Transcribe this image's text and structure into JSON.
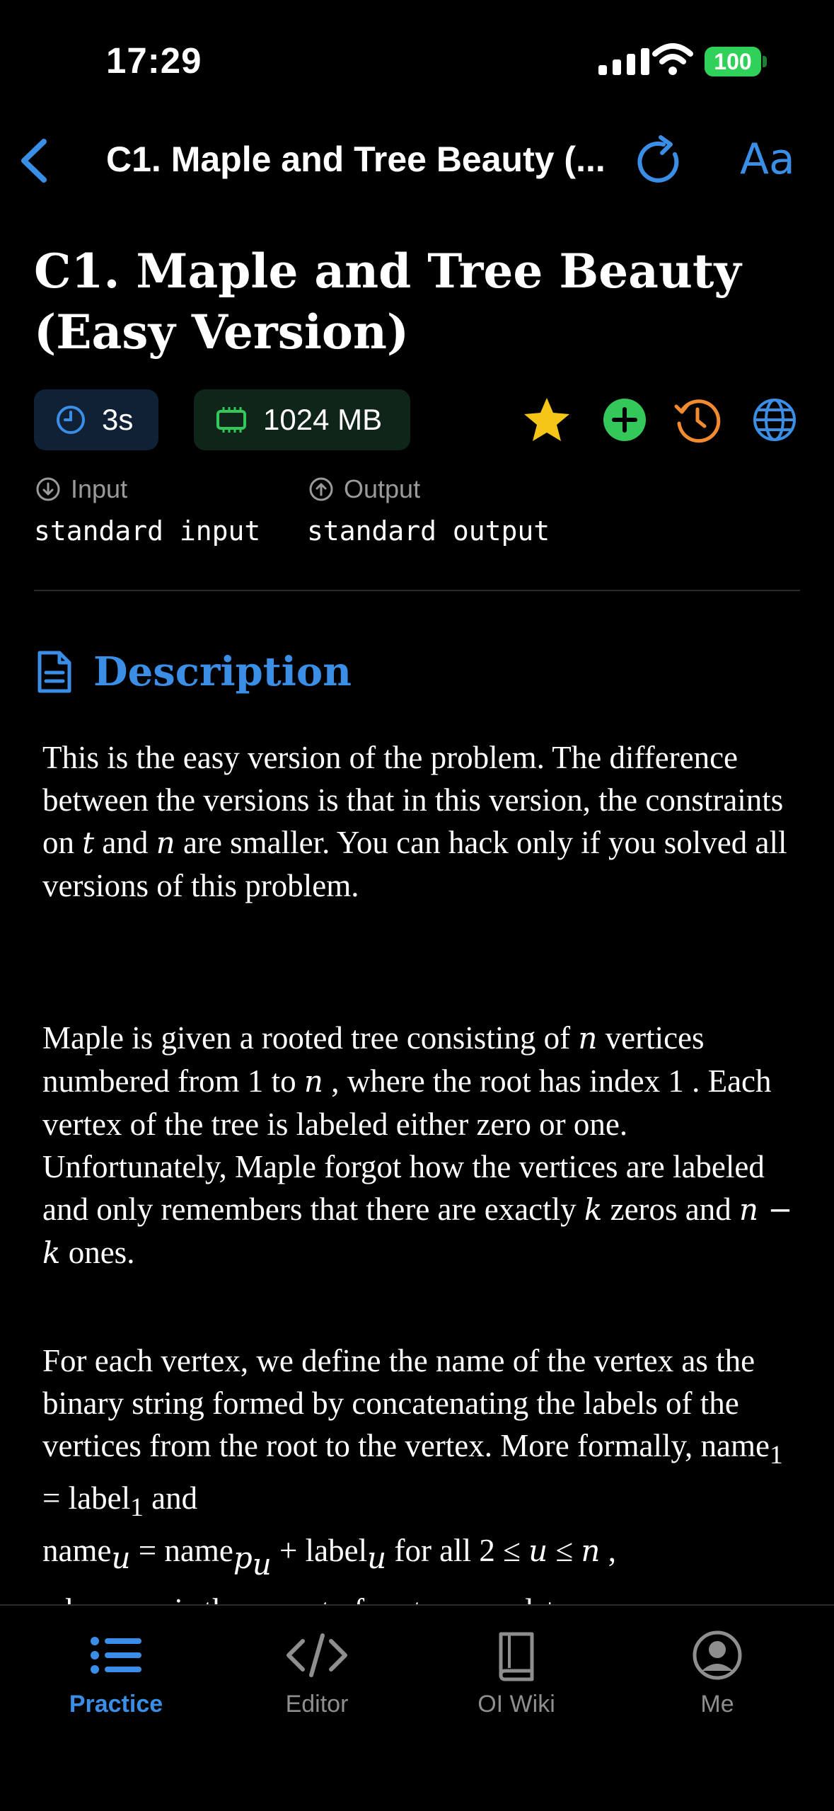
{
  "status": {
    "time": "17:29",
    "battery": "100"
  },
  "nav": {
    "title": "C1. Maple and Tree Beauty (...",
    "font_label": "Aa"
  },
  "problem": {
    "title_line1": "C1. Maple and Tree Beauty",
    "title_line2": "(Easy Version)",
    "time_limit": "3s",
    "memory_limit": "1024 MB",
    "input_label": "Input",
    "input_value": "standard input",
    "output_label": "Output",
    "output_value": "standard output"
  },
  "description": {
    "heading": "Description",
    "p1": {
      "a": "This is the easy version of the problem. The difference between the versions is that in this version, the constraints on ",
      "t": "t",
      "b": " and ",
      "n": "n",
      "c": " are smaller. You can hack only if you solved all versions of this problem."
    },
    "p2": {
      "a": "Maple is given a rooted tree consisting of ",
      "n1": "n",
      "b": " vertices numbered from 1 to ",
      "n2": "n",
      "c": " , where the root has index 1 . Each vertex of the tree is labeled either zero or one. Unfortunately, Maple forgot how the vertices are labeled and only remembers that there are exactly ",
      "k": "k",
      "d": " zeros and ",
      "nk": "n − k",
      "e": " ones."
    },
    "p3": {
      "a": "For each vertex, we define the name of the vertex as the binary string formed by concatenating the labels of the vertices from the root to the vertex. More formally, name",
      "s1": "1",
      "b": " = label",
      "s2": "1",
      "c": " and",
      "d": "name",
      "su": "u",
      "e": " = name",
      "spu": "p",
      "spu2": "u",
      "f": " + label",
      "su2": "u",
      "g": " for all 2 ≤ ",
      "u": "u",
      "h": " ≤ ",
      "n": "n",
      "i": " ,",
      "j": "where ",
      "pu": "p",
      "pu_sub": "u",
      "k": " is the parent of vertex ",
      "u2": "u",
      "l": " and +"
    }
  },
  "tabs": [
    {
      "label": "Practice",
      "icon": "list-icon"
    },
    {
      "label": "Editor",
      "icon": "code-icon"
    },
    {
      "label": "OI Wiki",
      "icon": "book-icon"
    },
    {
      "label": "Me",
      "icon": "person-icon"
    }
  ],
  "colors": {
    "accent": "#3a8ee6",
    "star": "#f5c518",
    "add": "#34c759",
    "history": "#f28b30",
    "battery": "#30d158"
  }
}
